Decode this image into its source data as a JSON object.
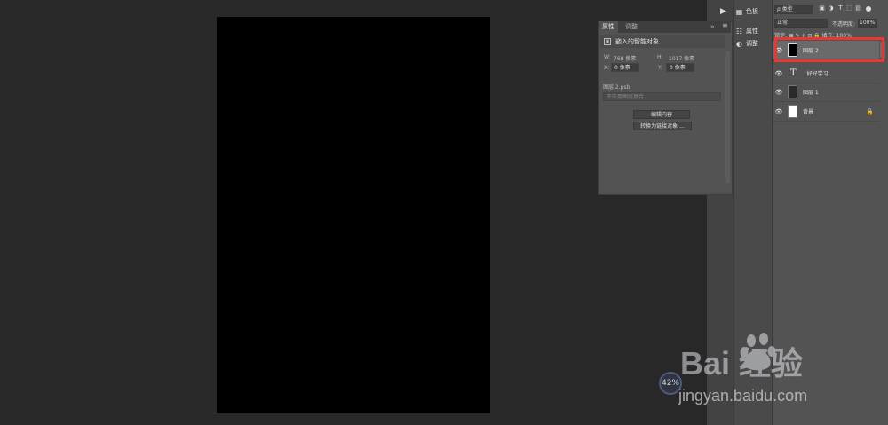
{
  "properties_panel": {
    "tabs": [
      "属性",
      "调整"
    ],
    "menu_glyph": "››",
    "close_glyph": "≡",
    "header_title": "嵌入的智能对象",
    "w_label": "W:",
    "w_value": "768 像素",
    "h_label": "H:",
    "h_value": "1017 像素",
    "x_label": "X:",
    "x_value": "0 像素",
    "y_label": "Y:",
    "y_value": "0 像素",
    "source_file": "图层 2.psb",
    "comp_placeholder": "不应用图层复合",
    "edit_contents_button": "编辑内容",
    "convert_linked_button": "转换为链接对象 ..."
  },
  "mid_column": {
    "items": [
      {
        "label": "色板",
        "icon": "swatches-icon"
      },
      {
        "label": "属性",
        "icon": "properties-icon"
      },
      {
        "label": "调整",
        "icon": "adjustments-icon"
      }
    ]
  },
  "layers_panel": {
    "filter_kind": "ρ 类型",
    "blend_mode": "正常",
    "opacity_label": "不透明度:",
    "opacity_value": "100%",
    "lock_text": "锁定: ▦ ✎ ✛ ⊡ 🔒   填充: 100%",
    "layers": [
      {
        "name": "图层 2",
        "type": "smart-object",
        "selected": true,
        "thumb": "#000000"
      },
      {
        "name": "好好学习",
        "type": "text",
        "selected": false
      },
      {
        "name": "图层 1",
        "type": "pixel",
        "selected": false,
        "thumb": "#2a2a2a"
      },
      {
        "name": "背景",
        "type": "background",
        "selected": false,
        "thumb": "#ffffff",
        "locked": true
      }
    ]
  },
  "zoom_badge": "42%",
  "watermark": {
    "brand": "Bai 经验",
    "url": "jingyan.baidu.com"
  },
  "colors": {
    "canvas": "#000000",
    "workspace": "#282828",
    "panel": "#535353",
    "highlight": "#e53935"
  }
}
